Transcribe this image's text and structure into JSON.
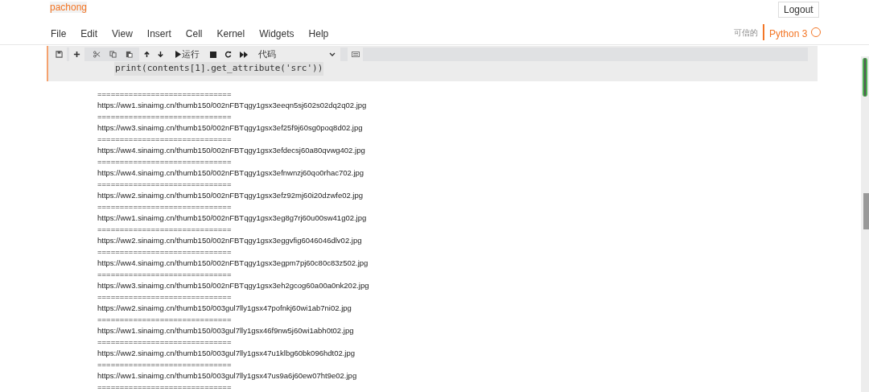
{
  "notebook_name": "pachong",
  "logout": "Logout",
  "menu": [
    "File",
    "Edit",
    "View",
    "Insert",
    "Cell",
    "Kernel",
    "Widgets",
    "Help"
  ],
  "trusted": "可信的",
  "kernel": {
    "name": "Python 3",
    "busy": false
  },
  "toolbar": {
    "run_label": "运行",
    "cell_type": "代码"
  },
  "cell": {
    "code": "print(contents[1].get_attribute('src'))",
    "selected": true
  },
  "output": [
    "==============================",
    "https://ww1.sinaimg.cn/thumb150/002nFBTqgy1gsx3eeqn5sj602s02dq2q02.jpg",
    "==============================",
    "https://ww3.sinaimg.cn/thumb150/002nFBTqgy1gsx3ef25f9j60sg0poq8d02.jpg",
    "==============================",
    "https://ww4.sinaimg.cn/thumb150/002nFBTqgy1gsx3efdecsj60a80qvwg402.jpg",
    "==============================",
    "https://ww4.sinaimg.cn/thumb150/002nFBTqgy1gsx3efnwnzj60qo0rhac702.jpg",
    "==============================",
    "https://ww2.sinaimg.cn/thumb150/002nFBTqgy1gsx3efz92mj60i20dzwfe02.jpg",
    "==============================",
    "https://ww1.sinaimg.cn/thumb150/002nFBTqgy1gsx3eg8g7rj60u00sw41g02.jpg",
    "==============================",
    "https://ww2.sinaimg.cn/thumb150/002nFBTqgy1gsx3eggvfig6046046dlv02.jpg",
    "==============================",
    "https://ww4.sinaimg.cn/thumb150/002nFBTqgy1gsx3egpm7pj60c80c83z502.jpg",
    "==============================",
    "https://ww3.sinaimg.cn/thumb150/002nFBTqgy1gsx3eh2gcog60a00a0nk202.jpg",
    "==============================",
    "https://ww2.sinaimg.cn/thumb150/003gul7lly1gsx47pofnkj60wi1ab7ni02.jpg",
    "==============================",
    "https://ww1.sinaimg.cn/thumb150/003gul7lly1gsx46f9nw5j60wi1abh0t02.jpg",
    "==============================",
    "https://ww2.sinaimg.cn/thumb150/003gul7lly1gsx47u1klbg60bk096hdt02.jpg",
    "==============================",
    "https://ww1.sinaimg.cn/thumb150/003gul7lly1gsx47us9a6j60ew07ht9e02.jpg",
    "=============================="
  ]
}
